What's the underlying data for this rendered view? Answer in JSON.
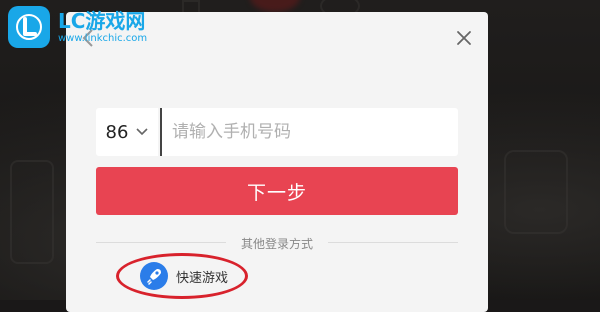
{
  "watermark": {
    "title": "LC游戏网",
    "url": "www.linkchic.com",
    "color": "#19a7e8"
  },
  "login": {
    "country_code": "86",
    "phone_placeholder": "请输入手机号码",
    "next_label": "下一步",
    "other_methods_label": "其他登录方式",
    "quick_game_label": "快速游戏",
    "accent_color": "#e84452"
  },
  "icons": {
    "back": "chevron-left-icon",
    "close": "close-icon",
    "dropdown": "chevron-down-icon",
    "quick_game": "rocket-icon"
  }
}
